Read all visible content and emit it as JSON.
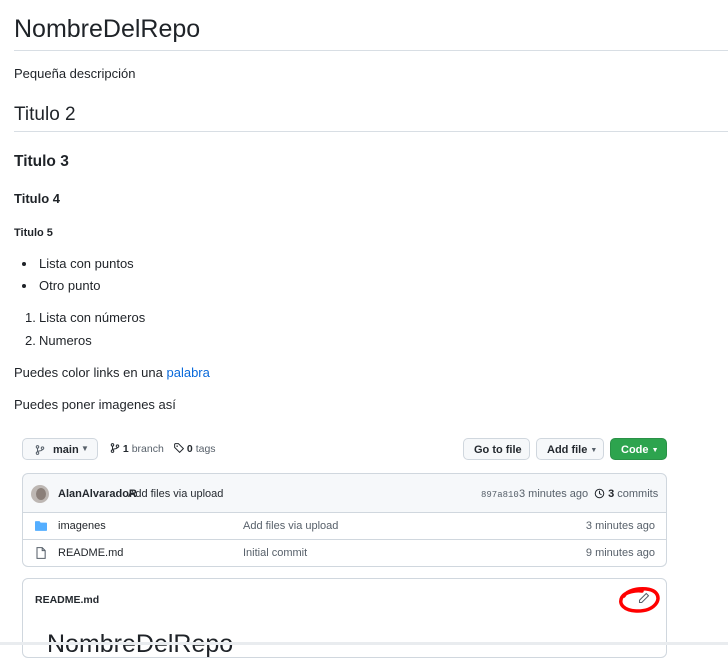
{
  "readme": {
    "title": "NombreDelRepo",
    "description": "Pequeña descripción",
    "h2": "Titulo 2",
    "h3": "Titulo 3",
    "h4": "Titulo 4",
    "h5": "Titulo 5",
    "bullets": [
      "Lista con puntos",
      "Otro punto"
    ],
    "numbered": [
      "Lista con números",
      "Numeros"
    ],
    "numbers": [
      "1.",
      "2."
    ],
    "link_sentence_prefix": "Puedes color links en una ",
    "link_text": "palabra",
    "images_sentence": "Puedes poner imagenes así"
  },
  "repo_screenshot": {
    "branch_button": "main",
    "branches_count": "1",
    "branches_label": "branch",
    "tags_count": "0",
    "tags_label": "tags",
    "go_to_file": "Go to file",
    "add_file": "Add file",
    "code": "Code",
    "commit": {
      "author": "AlanAlvaradoR",
      "message": "Add files via upload",
      "hash": "897a810",
      "time": "3 minutes ago",
      "commits_count": "3",
      "commits_label": "commits"
    },
    "files": [
      {
        "name": "imagenes",
        "type": "folder",
        "message": "Add files via upload",
        "time": "3 minutes ago"
      },
      {
        "name": "README.md",
        "type": "file",
        "message": "Initial commit",
        "time": "9 minutes ago"
      }
    ],
    "readme_header": "README.md",
    "readme_preview_title": "NombreDelRepo"
  },
  "colors": {
    "link": "#0969da",
    "green_button": "#2da44e",
    "annotation_red": "#ff0000"
  }
}
